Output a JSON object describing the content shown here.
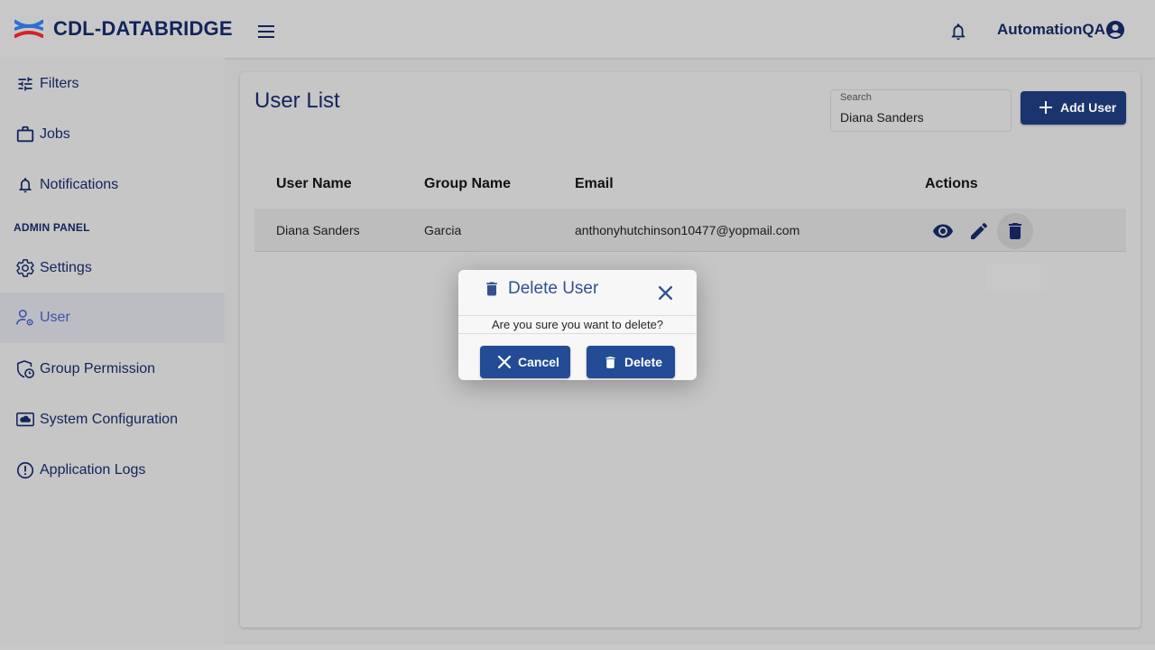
{
  "brand": {
    "name": "CDL-DATABRIDGE",
    "logo_icon": "databridge-logo-icon",
    "logo_colors": [
      "#2d6fd3",
      "#d8202a"
    ]
  },
  "header": {
    "menu_icon": "hamburger-menu-icon",
    "notification_icon": "bell-icon",
    "username": "AutomationQA",
    "avatar_icon": "account-circle-icon"
  },
  "sidebar": {
    "items": [
      {
        "label": "Filters",
        "icon": "tune-filters-icon",
        "active": false
      },
      {
        "label": "Jobs",
        "icon": "briefcase-icon",
        "active": false
      },
      {
        "label": "Notifications",
        "icon": "bell-icon",
        "active": false
      }
    ],
    "admin_section_label": "ADMIN PANEL",
    "admin_items": [
      {
        "label": "Settings",
        "icon": "gear-icon",
        "active": false
      },
      {
        "label": "User",
        "icon": "user-gear-icon",
        "active": true
      },
      {
        "label": "Group Permission",
        "icon": "shield-clock-icon",
        "active": false
      },
      {
        "label": "System Configuration",
        "icon": "cloud-screen-icon",
        "active": false
      },
      {
        "label": "Application Logs",
        "icon": "alert-circle-icon",
        "active": false
      }
    ]
  },
  "main": {
    "title": "User List",
    "search": {
      "label": "Search",
      "value": "Diana Sanders"
    },
    "add_button_label": "Add User",
    "table": {
      "columns": [
        "User Name",
        "Group Name",
        "Email",
        "Actions"
      ],
      "rows": [
        {
          "user_name": "Diana Sanders",
          "group_name": "Garcia",
          "email": "anthonyhutchinson10477@yopmail.com",
          "actions": [
            "eye-icon",
            "pencil-icon",
            "trash-icon"
          ]
        }
      ]
    }
  },
  "modal": {
    "title": "Delete User",
    "message": "Are you sure you want to delete?",
    "cancel_label": "Cancel",
    "delete_label": "Delete"
  },
  "colors": {
    "primary": "#1a346e",
    "modal_button": "#234b96",
    "title_text": "#12245a",
    "active_nav_text": "#3d52a8"
  }
}
